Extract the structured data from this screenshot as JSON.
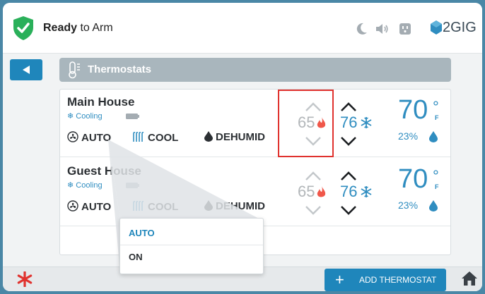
{
  "status": {
    "bold": "Ready",
    "rest": " to Arm"
  },
  "brand": {
    "logo_text": "2GIG"
  },
  "icons": {
    "shield": "check-shield-icon",
    "moon": "moon-icon",
    "speaker": "speaker-icon",
    "plug": "plug-icon",
    "back": "back-arrow-icon",
    "thermometer": "thermometer-icon",
    "asterisk": "asterisk-icon",
    "home": "home-icon"
  },
  "colors": {
    "accent": "#1f86bb",
    "cool": "#2f8dc0",
    "heat": "#f0574a",
    "frame": "#4a87a6",
    "highlight": "#e0322e"
  },
  "section": {
    "title": "Thermostats"
  },
  "thermostats": [
    {
      "name": "Main House",
      "mode": "Cooling",
      "fan": "AUTO",
      "system": "COOL",
      "dehumid": "DEHUMID",
      "heat_setpoint": "65",
      "cool_setpoint": "76",
      "temperature": "70",
      "degree": "°",
      "unit": "F",
      "humidity": "23%"
    },
    {
      "name": "Guest House",
      "mode": "Cooling",
      "fan": "AUTO",
      "system": "COOL",
      "dehumid": "DEHUMID",
      "heat_setpoint": "65",
      "cool_setpoint": "76",
      "temperature": "70",
      "degree": "°",
      "unit": "F",
      "humidity": "23%"
    }
  ],
  "fan_dropdown": {
    "options": [
      "AUTO",
      "ON"
    ],
    "selected": "AUTO"
  },
  "bottom": {
    "add_plus": "+",
    "add_label": "ADD THERMOSTAT"
  }
}
